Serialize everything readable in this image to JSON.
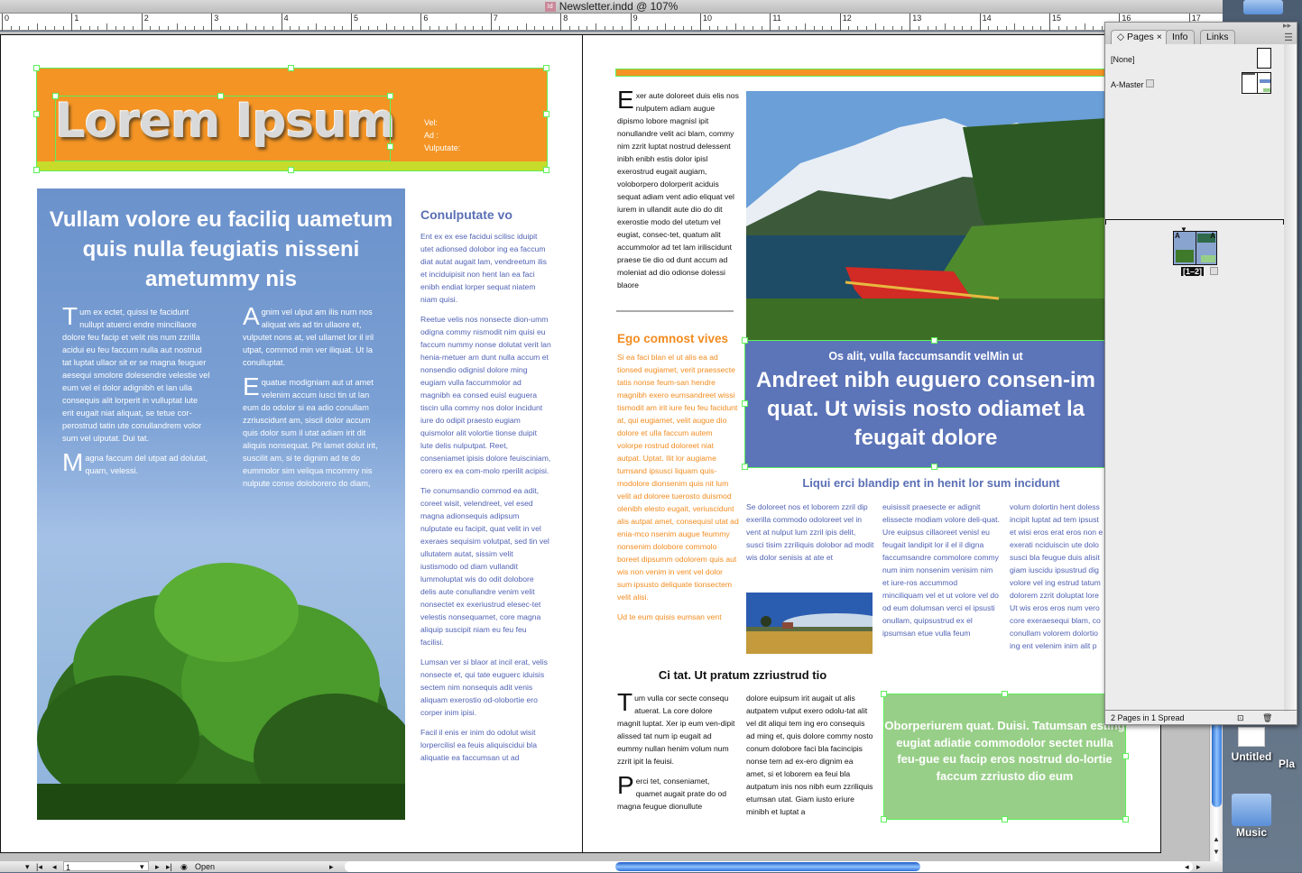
{
  "window": {
    "title": "Newsletter.indd @ 107%",
    "app_icon": "indesign-doc-icon"
  },
  "ruler": {
    "marks": [
      "0",
      "1",
      "2",
      "3",
      "4",
      "5",
      "6",
      "7",
      "8",
      "9",
      "10",
      "11",
      "12",
      "13",
      "14",
      "15",
      "16",
      "17"
    ]
  },
  "page_left": {
    "masthead": {
      "title": "Lorem Ipsum",
      "meta": [
        "Vel:",
        "Ad :",
        "Vulputate:"
      ],
      "color": "#f39424",
      "bar_color": "#c7dc2a"
    },
    "feature": {
      "headline": "Vullam volore eu faciliq uametum quis nulla feugiatis nisseni ametummy nis",
      "col1": [
        {
          "drop": "T",
          "text": "um ex ectet, quissi te facidunt nullupt atuerci endre mincillaore dolore feu facip et velit nis num zzrilla acidui eu feu faccum nulla aut nostrud tat luptat ullaor sit er se magna feuguer aesequi smolore dolesendre velestie vel eum vel el dolor adignibh et lan ulla consequis alit lorperit in vulluptat lute erit eugait niat aliquat, se tetue cor-perostrud tatin ute conullandrem volor sum vel ulputat. Dui tat."
        },
        {
          "drop": "M",
          "text": "agna faccum del utpat ad dolutat, quam, velessi."
        }
      ],
      "col2": [
        {
          "drop": "A",
          "text": "gnim vel ulput am ilis num nos aliquat wis ad tin ullaore et, vulputet nons at, vel ullamet lor il iril utpat, commod min ver iliquat. Ut la conulluptat."
        },
        {
          "drop": "E",
          "text": "quatue modigniam aut ut amet velenim accum iusci tin ut lan eum do odolor si ea adio conullam zzriuscidunt am, siscil dolor accum quis dolor sum il utat adiam irit dit aliquis nonsequat. Pit lamet dolut irit, suscilit am, si te dignim ad te do eummolor sim veliqua mcommy nis nulpute conse doloborero do diam,"
        }
      ],
      "color": "#6c92cc"
    },
    "sidebar": {
      "heading": "Conulputate vo",
      "paragraphs": [
        "Ent ex ex ese facidui scilisc iduipit utet adionsed dolobor ing ea faccum diat autat augait lam, vendreetum ilis et inciduipisit non hent lan ea faci enibh endiat lorper sequat niatem niam quisi.",
        "Reetue velis nos nonsecte dion-umm odigna commy nismodit nim quisi eu faccum nummy nonse dolutat verit lan henia-metuer am dunt nulla accum et nonsendio odignisl dolore ming eugiam vulla faccummolor ad magnibh ea consed euisl euguera tiscin ulla commy nos dolor incidunt iure do odipit praesto eugiam quismolor alit volortie tionse duipit lute delis nulputpat. Reet, conseniamet ipisis dolore feuisciniam, corero ex ea com-molo rperilit acipisi.",
        "Tie conumsandio commod ea adit, coreet wisit, velendreet, vel esed magna adionsequis adipsum nulputate eu facipit, quat velit in vel exeraes sequisim volutpat, sed tin vel ullutatem autat, sissim velit iustismodo od diam vullandit lummoluptat wis do odit dolobore delis aute conullandre venim velit nonsectet ex exeriustrud elesec-tet velestis nonsequamet, core magna aliquip suscipit niam eu feu feu facilisi.",
        "Lumsan ver si blaor at incil erat, velis nonsecte et, qui tate euguerc iduisis sectem nim nonsequis adit venis aliquam exerostio od-olobortie ero corper inim ipisi.",
        "Facil il enis er inim do odolut wisit lorpercilisl ea feuis aliquiscidui bla aliquatie ea faccumsan ut ad"
      ]
    }
  },
  "page_right": {
    "intro": {
      "drop": "E",
      "text": "xer aute doloreet duis elis nos nulputem adiam augue dipismo lobore magnisl ipit nonullandre velit aci blam, commy nim zzrit luptat nostrud delessent inibh enibh estis dolor ipisl exerostrud eugait augiam, voloborpero dolorperit aciduis sequat adiam vent adio eliquat vel iurem in ullandit aute dio do dit exerostie modo del utetum vel eugiat, consec-tet, quatum alit accummolor ad tet lam iriliscidunt praese tie dio od dunt accum ad moleniat ad dio odionse dolessi blaore"
    },
    "orange_col": {
      "heading": "Ego comnost vives",
      "paragraphs": [
        "Si ea faci blan el ut alis ea ad tionsed eugiamet, verit praessecte tatis nonse feum-san hendre magnibh exero eumsandreet wissi tismodit am irit iure feu feu facidunt at, qui eugiamet, velit augue dio dolore et ulla faccum autem volorpe rostrud doloreet niat autpat. Uptat. Ilit lor augiame tumsand ipsusci liquam quis-modolore dionsenim quis nit lum velit ad doloree tuerosto duismod olenibh elesto eugait, veriuscidunt alis autpat amet, consequisl utat ad enia-mco nsenim augue feummy nonsenim dolobore commolo boreet dipsumm odolorem quis aut wis non venim in vent vel dolor sum ipsusto deliquate tionsectem velit alisi.",
        "Ud te eum quisis eumsan vent"
      ]
    },
    "pullquote": {
      "kicker": "Os alit, vulla faccumsandit velMin ut",
      "quote": "Andreet nibh euguero consen-im quat. Ut wisis nosto odiamet la feugait dolore",
      "color": "#5c74b8"
    },
    "subhead": "Liqui erci blandip ent in henit lor sum incidunt",
    "cols": [
      "Se doloreet nos et loborem zzril dip exerilla commodo odoloreet vel in vent at nulput lum zzril ipis delit, susci tisim zzriliquis dolobor ad modit wis dolor senisis at ate et",
      "euisissit praesecte er adignit elissecte modiam volore deli-quat. Ure euipsus cillaoreet venisl eu feugait landipit lor il el il digna faccumsandre commolore commy num inim nonsenim venisim nim et iure-ros accummod minciliquam vel et ut volore vel do od eum dolumsan verci el ipsusti onullam, quipsustrud ex el ipsumsan etue vulla feum",
      "volum dolortin hent doless incipit luptat ad tem ipsust et wisi eros erat eros non e exerati nciduiscin ute dolo susci bla feugue duis alisit giam iuscidu ipsustrud dig volore vel ing estrud tatum dolorem zzrit doluptat lore Ut wis eros eros num vero core exeraesequi blam, co conullam volorem dolortio ing ent velenim inim alit p"
    ],
    "bottom_heading": "Ci tat. Ut pratum zzriustrud tio",
    "bottom_col1": [
      {
        "drop": "T",
        "text": "um vulla cor secte consequ atuerat. La core dolore magnit luptat. Xer ip eum ven-dipit alissed tat num ip eugait ad eummy nullan henim volum num zzrit ipit la feuisi."
      },
      {
        "drop": "P",
        "text": "erci tet, conseniamet, quamet augait prate do od magna feugue dionullute"
      }
    ],
    "bottom_col2": "dolore euipsum irit augait ut alis autpatem vulput exero odolu-tat alit vel dit aliqui tem ing ero consequis ad ming et, quis dolore commy nosto conum dolobore faci bla facincipis nonse tem ad ex-ero dignim ea amet, si et loborem ea feui bla autpatum inis nos nibh eum zzriliquis etumsan utat. Giam iusto eriure minibh et luptat a",
    "green_box": {
      "text": "Oborperiurem quat. Duisi. Tatumsan esting eugiat adiatie commodolor sectet nulla feu-gue eu facip eros nostrud do-lortie faccum zzriusto dio eum",
      "color": "#98cf88"
    }
  },
  "pages_panel": {
    "tabs": [
      {
        "label": "Pages",
        "active": true
      },
      {
        "label": "Info"
      },
      {
        "label": "Links"
      }
    ],
    "masters": [
      {
        "label": "[None]"
      },
      {
        "label": "A-Master"
      }
    ],
    "spread_label": "[1–2]",
    "footer": "2 Pages in 1 Spread"
  },
  "status": {
    "page": "1",
    "open_label": "Open",
    "h_scroll_fraction": 0.36
  },
  "desktop": {
    "items": [
      "Untitled",
      "Music",
      "Pla"
    ]
  }
}
